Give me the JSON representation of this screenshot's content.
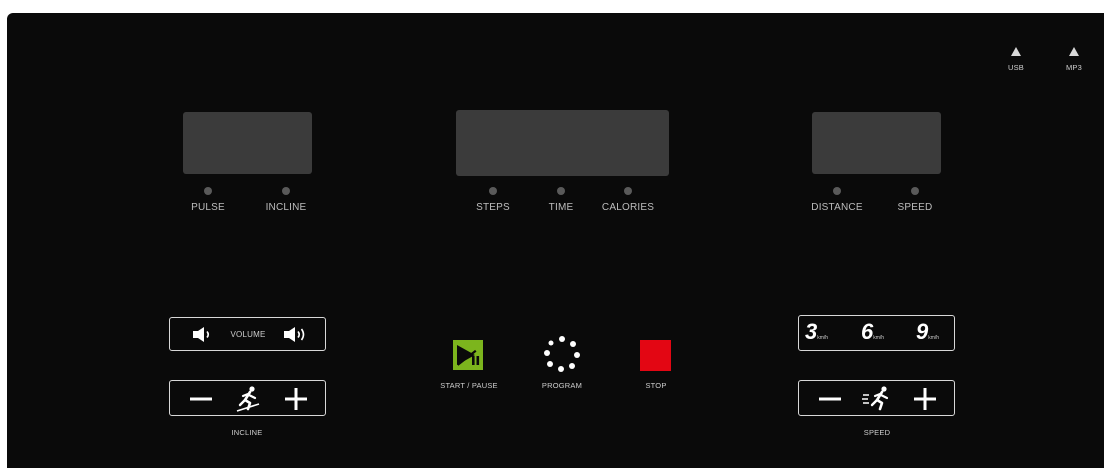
{
  "ports": {
    "usb_label": "USB",
    "mp3_label": "MP3"
  },
  "indicators": {
    "pulse": "PULSE",
    "incline": "INCLINE",
    "steps": "STEPS",
    "time": "TIME",
    "calories": "CALORIES",
    "distance": "DISTANCE",
    "speed": "SPEED"
  },
  "volume": {
    "label": "VOLUME"
  },
  "incline_control": {
    "label": "INCLINE"
  },
  "speed_control": {
    "label": "SPEED"
  },
  "quick_speed": [
    {
      "value": "3",
      "unit": "km/h"
    },
    {
      "value": "6",
      "unit": "km/h"
    },
    {
      "value": "9",
      "unit": "km/h"
    }
  ],
  "buttons": {
    "start_pause": "START / PAUSE",
    "program": "PROGRAM",
    "stop": "STOP"
  },
  "colors": {
    "background": "#0a0a0a",
    "display": "#3b3b3b",
    "start_pause": "#7cb51d",
    "stop": "#e30613"
  },
  "icons": {
    "usb": "triangle-up-icon",
    "mp3": "triangle-up-icon",
    "volume_down": "speaker-low-icon",
    "volume_up": "speaker-high-icon",
    "incline_runner": "incline-runner-icon",
    "speed_runner": "running-man-icon",
    "program": "dotted-circle-icon"
  }
}
